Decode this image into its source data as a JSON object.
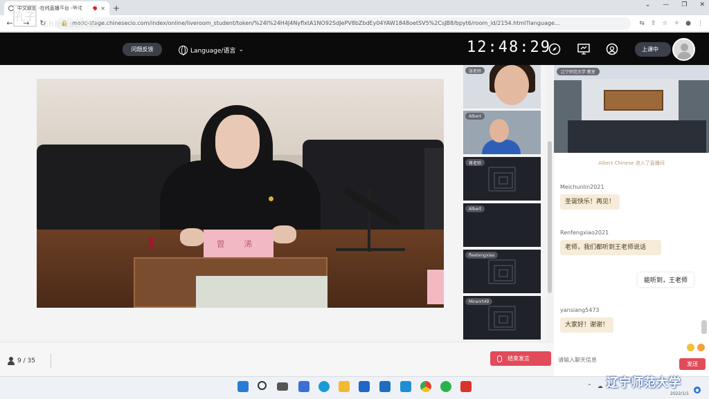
{
  "browser": {
    "tab_title": "中文联盟 -在线直播平台 -测试",
    "new_tab": "+",
    "url": "mooc-stage.chinesecio.com/index/online/liveroom_student/token/%24I%24H4J4NyflxtA1NO92SdJePV8bZbdEy04YAW1848oetSV5%2CsJB8/bpyt6/room_id/2154.html?language..."
  },
  "header": {
    "logo_seal": "孔子",
    "logo_cn": "中文联盟",
    "logo_en": "ChinesePlus",
    "feedback_label": "问题反馈",
    "language_label": "Language/语言",
    "clock": "12:48:29",
    "in_class_label": "上课中"
  },
  "main": {
    "nameplate": "曾 浠"
  },
  "thumbnails": [
    {
      "label": "张老师"
    },
    {
      "label": "Albert"
    },
    {
      "label": "蒋老师"
    },
    {
      "label": "Albert"
    },
    {
      "label": "fleetengxiao"
    },
    {
      "label": "Miranrt49"
    }
  ],
  "chat": {
    "room_label": "辽宁师范大学 教室",
    "system_message": "Albert Chinese 进入了直播间",
    "messages": [
      {
        "name": "Meichunlin2021",
        "text": "圣诞快乐！再见！"
      },
      {
        "name": "Renfengxiao2021",
        "text": "老师，我们都听到王老师说话"
      },
      {
        "name": "",
        "text": "能听到，王老师"
      },
      {
        "name": "yansiang5473",
        "text": "大家好！谢谢！"
      }
    ],
    "input_placeholder": "请输入聊天信息",
    "send_label": "发送"
  },
  "bottom": {
    "participants": "9 / 35",
    "mute_label": "结束发言"
  },
  "taskbar": {
    "watermark": "辽宁师范大学",
    "date": "2022/1/1"
  }
}
